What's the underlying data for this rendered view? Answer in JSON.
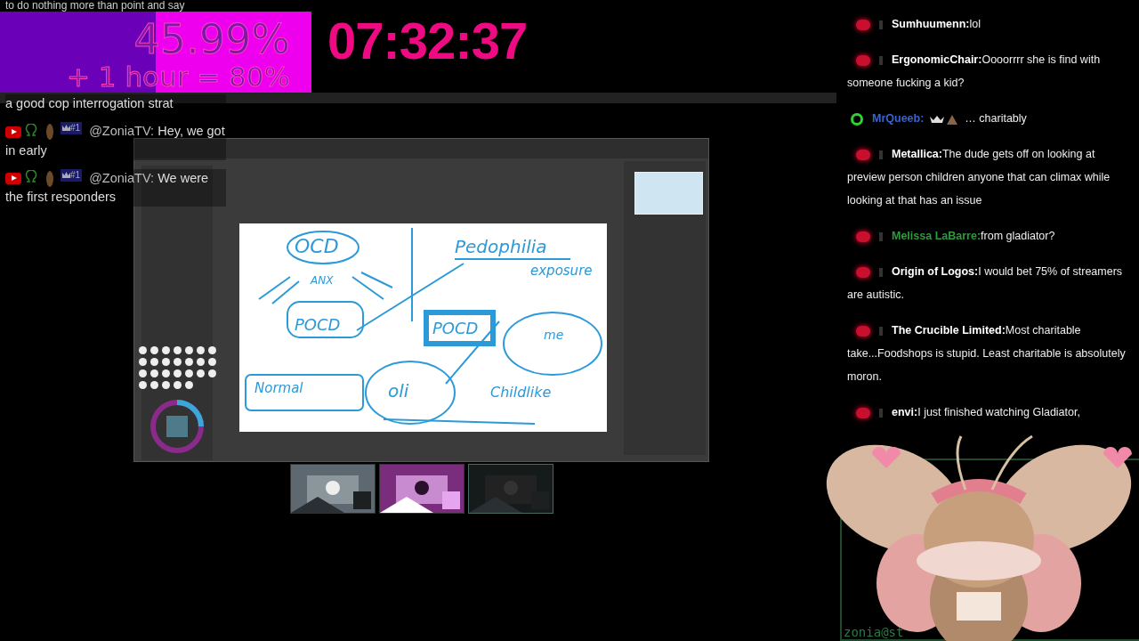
{
  "top_chat_line": "to do nothing more than point and say",
  "goal": {
    "percent": "45.99%",
    "bonus": "+ 1 hour = 80%",
    "level": 0.5
  },
  "timer": "07:32:37",
  "left_chat": [
    {
      "kind": "continuation",
      "text": "a good cop interrogation strat"
    },
    {
      "kind": "message",
      "author": "@ZoniaTV:",
      "badge": "#1",
      "text": "Hey, we got in early"
    },
    {
      "kind": "message",
      "author": "@ZoniaTV:",
      "badge": "#1",
      "text": "We were the first responders"
    }
  ],
  "sketch": {
    "labels": [
      "OCD",
      "ANX",
      "POCD",
      "Pedophilia",
      "exposure",
      "POCD",
      "me",
      "Normal",
      "oli",
      "Childlike"
    ]
  },
  "right_chat": [
    {
      "kind": "youtube",
      "author": "Sumhuumenn:",
      "color": "#ffffff",
      "text": "lol"
    },
    {
      "kind": "youtube",
      "author": "ErgonomicChair:",
      "color": "#ffffff",
      "text": "Oooorrrr she is find with someone fucking a kid?"
    },
    {
      "kind": "ring",
      "author": "MrQueeb:",
      "color": "#3b63c9",
      "text": "… charitably",
      "emotes": true
    },
    {
      "kind": "youtube",
      "author": "Metallica:",
      "color": "#ffffff",
      "text": "The dude gets off on looking at preview person children anyone that can climax while looking at that has an issue"
    },
    {
      "kind": "youtube",
      "author": "Melissa LaBarre:",
      "color": "#2f9a3c",
      "text": "from gladiator?"
    },
    {
      "kind": "youtube",
      "author": "Origin of Logos:",
      "color": "#ffffff",
      "text": "I would bet 75% of streamers are autistic."
    },
    {
      "kind": "youtube",
      "author": "The Crucible Limited:",
      "color": "#ffffff",
      "text": "Most charitable take...Foodshops is stupid. Least charitable is absolutely moron."
    },
    {
      "kind": "youtube",
      "author": "envi:",
      "color": "#ffffff",
      "text": "I just finished watching Gladiator,"
    }
  ],
  "avatar_caption": "zonia@st"
}
